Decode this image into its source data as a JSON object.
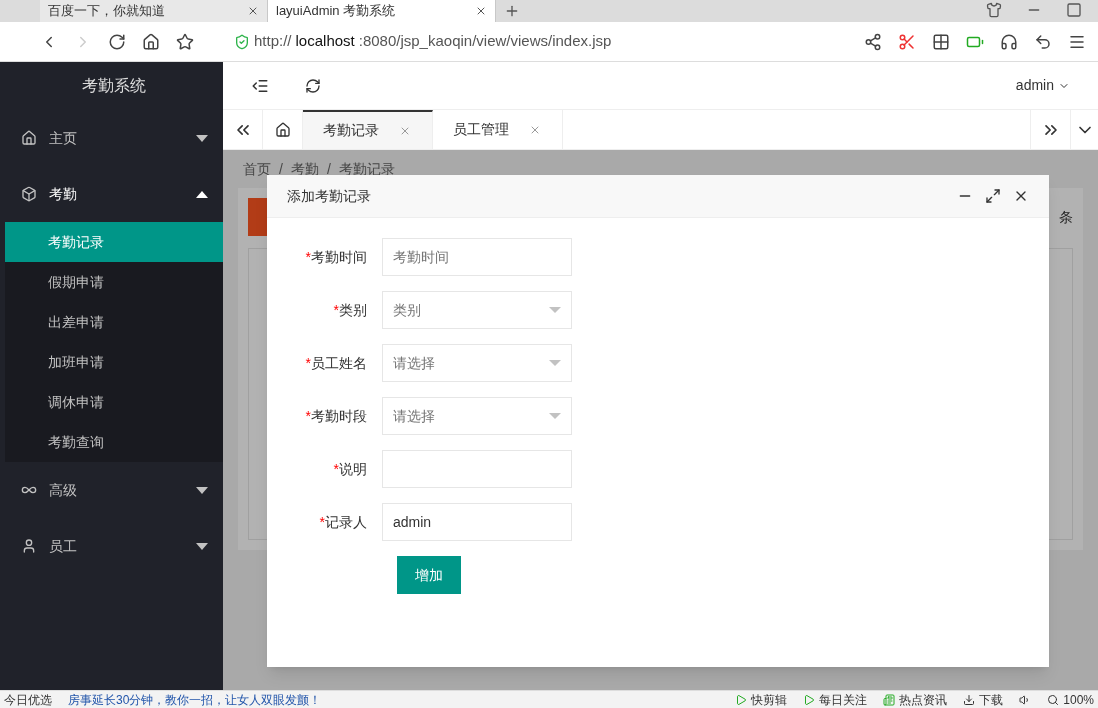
{
  "browser": {
    "tabs": [
      {
        "title": "百度一下，你就知道",
        "selected": false
      },
      {
        "title": "layuiAdmin 考勤系统",
        "selected": true
      }
    ],
    "url_host": "localhost",
    "url_rest": ":8080/jsp_kaoqin/view/views/index.jsp",
    "url_scheme": "http://"
  },
  "sidebar": {
    "title": "考勤系统",
    "items": [
      {
        "label": "主页",
        "expanded": false
      },
      {
        "label": "考勤",
        "expanded": true,
        "children": [
          {
            "label": "考勤记录",
            "selected": true
          },
          {
            "label": "假期申请",
            "selected": false
          },
          {
            "label": "出差申请",
            "selected": false
          },
          {
            "label": "加班申请",
            "selected": false
          },
          {
            "label": "调休申请",
            "selected": false
          },
          {
            "label": "考勤查询",
            "selected": false
          }
        ]
      },
      {
        "label": "高级",
        "expanded": false
      },
      {
        "label": "员工",
        "expanded": false
      }
    ]
  },
  "header": {
    "user": "admin"
  },
  "page_tabs": [
    {
      "label": "考勤记录",
      "selected": true
    },
    {
      "label": "员工管理",
      "selected": false
    }
  ],
  "breadcrumb": {
    "items": [
      "首页",
      "考勤",
      "考勤记录"
    ],
    "separator": "/"
  },
  "background_page": {
    "unit": "条"
  },
  "dialog": {
    "title": "添加考勤记录",
    "fields": [
      {
        "label": "考勤时间",
        "kind": "input",
        "placeholder": "考勤时间"
      },
      {
        "label": "类别",
        "kind": "select",
        "placeholder": "类别"
      },
      {
        "label": "员工姓名",
        "kind": "select",
        "placeholder": "请选择"
      },
      {
        "label": "考勤时段",
        "kind": "select",
        "placeholder": "请选择"
      },
      {
        "label": "说明",
        "kind": "input"
      },
      {
        "label": "记录人",
        "kind": "input",
        "value": "admin"
      }
    ],
    "required_mark": "*",
    "submit": "增加"
  },
  "status_bar": {
    "left": "今日优选",
    "news": "房事延长30分钟，教你一招，让女人双眼发颤！",
    "items": [
      "快剪辑",
      "每日关注",
      "热点资讯",
      "下载"
    ],
    "zoom": "100%"
  }
}
